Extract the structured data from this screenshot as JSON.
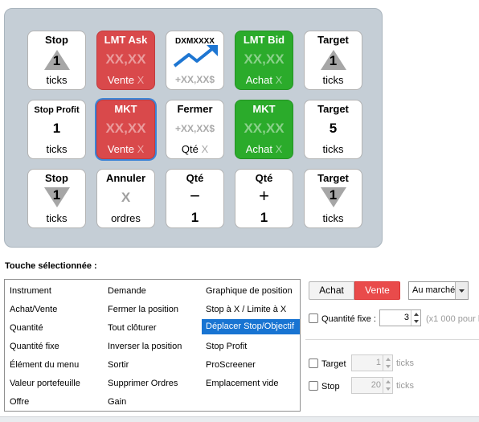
{
  "keys": {
    "k1": {
      "title": "Stop",
      "value": "1",
      "bottom": "ticks"
    },
    "k2": {
      "title": "LMT Ask",
      "placeholder": "XX,XX",
      "bottom": "Vente",
      "x": "X"
    },
    "k3": {
      "title": "DXMXXXX",
      "sub": "+XX,XX$"
    },
    "k4": {
      "title": "LMT Bid",
      "placeholder": "XX,XX",
      "bottom": "Achat",
      "x": "X"
    },
    "k5": {
      "title": "Target",
      "value": "1",
      "bottom": "ticks"
    },
    "k6": {
      "title": "Stop Profit",
      "value": "1",
      "bottom": "ticks"
    },
    "k7": {
      "title": "MKT",
      "placeholder": "XX,XX",
      "bottom": "Vente",
      "x": "X"
    },
    "k8": {
      "title": "Fermer",
      "placeholder": "+XX,XX$",
      "bottom": "Qté",
      "x": "X"
    },
    "k9": {
      "title": "MKT",
      "placeholder": "XX,XX",
      "bottom": "Achat",
      "x": "X"
    },
    "k10": {
      "title": "Target",
      "value": "5",
      "bottom": "ticks"
    },
    "k11": {
      "title": "Stop",
      "value": "1",
      "bottom": "ticks"
    },
    "k12": {
      "title": "Annuler",
      "value": "X",
      "bottom": "ordres"
    },
    "k13": {
      "title": "Qté",
      "sign": "−",
      "value": "1"
    },
    "k14": {
      "title": "Qté",
      "sign": "+",
      "value": "1"
    },
    "k15": {
      "title": "Target",
      "value": "1",
      "bottom": "ticks"
    }
  },
  "section_label": "Touche sélectionnée :",
  "list_items": [
    "Instrument",
    "Achat/Vente",
    "Quantité",
    "Quantité fixe",
    "Élément du menu",
    "Valeur portefeuille",
    "Offre",
    "Demande",
    "Fermer la position",
    "Tout clôturer",
    "Inverser la position",
    "Sortir",
    "Supprimer Ordres",
    "Gain",
    "Graphique de position",
    "Stop à X / Limite à X",
    "Déplacer Stop/Objectif",
    "Stop Profit",
    "ProScreener",
    "Emplacement vide"
  ],
  "selected_item": "Déplacer Stop/Objectif",
  "side": {
    "achat": "Achat",
    "vente": "Vente",
    "active": "Vente"
  },
  "order_type": "Au marché",
  "fixed_qty": {
    "label": "Quantité fixe :",
    "value": "3",
    "note": "(x1 000 pour l"
  },
  "target": {
    "label": "Target",
    "value": "1",
    "unit": "ticks"
  },
  "stop": {
    "label": "Stop",
    "value": "20",
    "unit": "ticks"
  },
  "colors": {
    "red": "#d9494b",
    "green": "#2bab2b",
    "selection": "#1874d2"
  }
}
